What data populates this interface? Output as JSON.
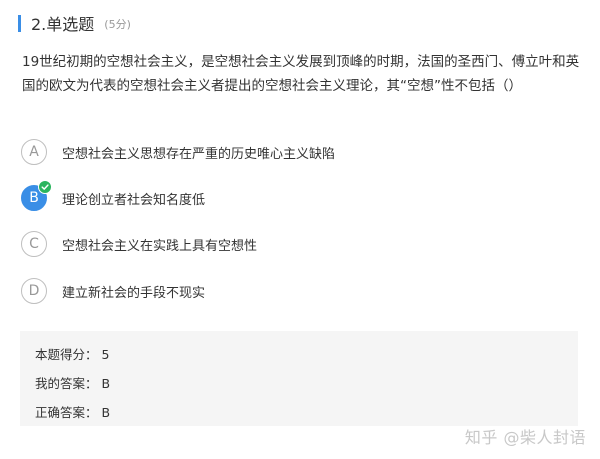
{
  "question": {
    "title": "2.单选题",
    "score": "(5分)",
    "stem": "19世纪初期的空想社会主义，是空想社会主义发展到顶峰的时期，法国的圣西门、傅立叶和英国的欧文为代表的空想社会主义者提出的空想社会主义理论，其“空想”性不包括（）"
  },
  "options": [
    {
      "letter": "A",
      "text": "空想社会主义思想存在严重的历史唯心主义缺陷"
    },
    {
      "letter": "B",
      "text": "理论创立者社会知名度低"
    },
    {
      "letter": "C",
      "text": "空想社会主义在实践上具有空想性"
    },
    {
      "letter": "D",
      "text": "建立新社会的手段不现实"
    }
  ],
  "selected_option": "B",
  "result": {
    "score_label": "本题得分：",
    "score_value": "5",
    "my_answer_label": "我的答案：",
    "my_answer_value": "B",
    "correct_answer_label": "正确答案：",
    "correct_answer_value": "B"
  },
  "watermark": "知乎 @柴人封语",
  "colors": {
    "accent": "#3a8ee6",
    "correct": "#2bb55e"
  },
  "icons": {
    "correct": "checkmark-icon"
  }
}
